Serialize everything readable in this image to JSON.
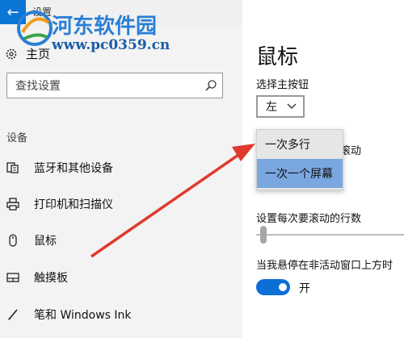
{
  "app": {
    "title": "设置",
    "back_icon": "back-arrow-icon"
  },
  "watermark": {
    "name": "河东软件园",
    "url": "www.pc0359.cn"
  },
  "sidebar": {
    "home_label": "主页",
    "search_placeholder": "查找设置",
    "section_title": "设备",
    "items": [
      {
        "label": "蓝牙和其他设备",
        "icon": "bluetooth-devices-icon"
      },
      {
        "label": "打印机和扫描仪",
        "icon": "printer-icon"
      },
      {
        "label": "鼠标",
        "icon": "mouse-icon",
        "active": true
      },
      {
        "label": "触摸板",
        "icon": "touchpad-icon"
      },
      {
        "label": "笔和 Windows Ink",
        "icon": "pen-icon"
      }
    ]
  },
  "main": {
    "title": "鼠标",
    "primary_button_label": "选择主按钮",
    "primary_button_value": "左",
    "scroll_label_tail": "滚动",
    "scroll_options": [
      "一次多行",
      "一次一个屏幕"
    ],
    "scroll_options_selected": "一次一个屏幕",
    "lines_label": "设置每次要滚动的行数",
    "lines_slider_level": 0.03,
    "inactive_scroll_label": "当我悬停在非活动窗口上方时",
    "toggle_state_label": "开"
  },
  "colors": {
    "accent": "#0b6fd6",
    "selected_option": "#7aa7e0",
    "annotation_arrow": "#e0392f"
  }
}
